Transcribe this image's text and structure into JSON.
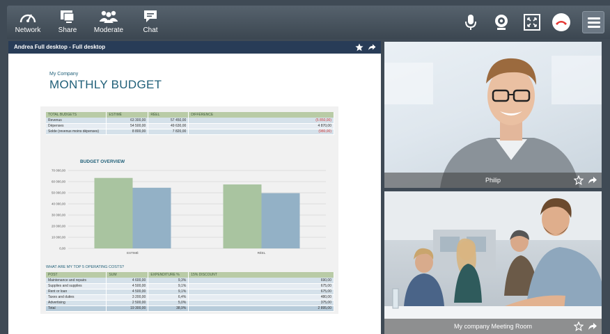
{
  "toolbar": {
    "tools": [
      {
        "label": "Network",
        "icon": "gauge-icon"
      },
      {
        "label": "Share",
        "icon": "monitor-share-icon"
      },
      {
        "label": "Moderate",
        "icon": "people-group-icon"
      },
      {
        "label": "Chat",
        "icon": "chat-bubble-icon"
      }
    ],
    "controls": [
      "microphone-icon",
      "webcam-icon",
      "fullscreen-icon",
      "hang-up-icon",
      "menu-icon"
    ]
  },
  "desktop": {
    "title": "Andrea Full desktop - Full desktop",
    "company": "My Company",
    "doc_title": "MONTHLY BUDGET",
    "summary": {
      "headers": [
        "TOTAL BUDGETS",
        "ESTIMÉ",
        "RÉEL",
        "DIFFÉRENCE"
      ],
      "rows": [
        [
          "Revenus",
          "63 300,00",
          "57 450,00",
          "(5 850,00)"
        ],
        [
          "Dépenses",
          "54 500,00",
          "49 630,00",
          "4 870,00"
        ],
        [
          "Solde (revenus moins dépenses)",
          "8 800,00",
          "7 820,00",
          "(980,00)"
        ]
      ]
    },
    "chart_title": "BUDGET OVERVIEW",
    "costs_title": "WHAT ARE MY TOP 5 OPERATING COSTS?",
    "costs": {
      "headers": [
        "POST",
        "SUM",
        "EXPENDITURE %",
        "15% DISCOUNT"
      ],
      "rows": [
        [
          "Maintenance and repairs",
          "4 600,00",
          "9,3%",
          "690,00"
        ],
        [
          "Supplies and supplies",
          "4 500,00",
          "9,1%",
          "675,00"
        ],
        [
          "Rent or loan",
          "4 500,00",
          "9,1%",
          "675,00"
        ],
        [
          "Taxes and duties",
          "3 200,00",
          "6,4%",
          "480,00"
        ],
        [
          "Advertising",
          "2 500,00",
          "5,0%",
          "375,00"
        ]
      ],
      "total": [
        "Total",
        "19 300,00",
        "38,9%",
        "2 895,00"
      ]
    }
  },
  "chart_data": {
    "type": "bar",
    "categories": [
      "ESTIMÉ",
      "RÉEL"
    ],
    "series": [
      {
        "values": [
          63300,
          57450
        ],
        "color": "#a9c4a0"
      },
      {
        "values": [
          54500,
          49630
        ],
        "color": "#93b1c6"
      }
    ],
    "yticks": [
      "0,00",
      "10 000,00",
      "20 000,00",
      "30 000,00",
      "40 000,00",
      "50 000,00",
      "60 000,00",
      "70 000,00"
    ],
    "ylim": [
      0,
      70000
    ],
    "grid": true,
    "title": "BUDGET OVERVIEW"
  },
  "videos": [
    {
      "name": "Philip"
    },
    {
      "name": "My company Meeting Room"
    }
  ],
  "colors": {
    "accent": "#283c57",
    "title": "#1f5f78",
    "negative": "#d23a3a"
  }
}
